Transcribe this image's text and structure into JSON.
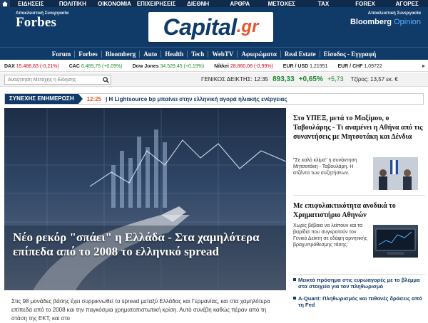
{
  "topnav": {
    "items": [
      "ΕΙΔΗΣΕΙΣ",
      "ΠΟΛΙΤΙΚΗ",
      "ΟΙΚΟΝΟΜΙΑ",
      "ΕΠΙΧΕΙΡΗΣΕΙΣ",
      "ΔΙΕΘΝΗ",
      "ΑΡΘΡΑ",
      "ΜΕΤΟΧΕΣ",
      "TAX",
      "FOREX",
      "ΑΓΟΡΕΣ"
    ]
  },
  "header": {
    "forbes_tag": "Αποκλειστική Συνεργασία",
    "forbes_logo": "Forbes",
    "capital_main": "Capital",
    "capital_tld": ".gr",
    "bloomberg_tag": "Αποκλειστική Συνεργασία",
    "bloomberg_name": "Bloomberg",
    "bloomberg_opinion": "Opinion"
  },
  "categories": [
    "Forum",
    "Forbes",
    "Bloomberg",
    "Auto",
    "Health",
    "Tech",
    "WebTV",
    "Αφιερώματα",
    "Real Estate",
    "Είσοδος - Εγγραφή"
  ],
  "ticker": [
    {
      "name": "DAX",
      "value": "15.486,83",
      "change": "(-0,21%)",
      "dir": "neg"
    },
    {
      "name": "CAC",
      "value": "6.489,75",
      "change": "(+0,09%)",
      "dir": "pos"
    },
    {
      "name": "Dow Jones",
      "value": "34.529,45",
      "change": "(+0,19%)",
      "dir": "pos"
    },
    {
      "name": "Nikkei",
      "value": "28.860,08",
      "change": "(-0,99%)",
      "dir": "neg"
    },
    {
      "name": "EUR / USD",
      "value": "1,21951",
      "change": "",
      "dir": ""
    },
    {
      "name": "EUR / CHF",
      "value": "1,09722",
      "change": "",
      "dir": ""
    }
  ],
  "search": {
    "placeholder": "Αναζήτηση Μετοχής ή Είδησης"
  },
  "index": {
    "label": "ΓΕΝΙΚΟΣ ΔΕΙΚΤΗΣ: 12:35",
    "value": "893,33",
    "percent": "+0,65%",
    "change": "+5,73",
    "volume": "Τζίρος: 13,57 εκ. €"
  },
  "latest": {
    "label": "ΣΥΝΕΧΗΣ ΕΝΗΜΕΡΩΣΗ",
    "time": "12:25",
    "text": "| Η Lightsource bp μπαίνει στην ελληνική αγορά ηλιακής ενέργειας"
  },
  "hero": {
    "title": "Νέο ρεκόρ \"σπάει\" η Ελλάδα - Στα χαμηλότερα επίπεδα από το 2008 το ελληνικό spread",
    "excerpt": "Στις 98 μονάδες βάσης έχει συρρικνωθεί το spread μεταξύ Ελλάδας και Γερμανίας, και στα χαμηλότερα επίπεδα από το 2008 και την παγκόσμια χρηματοπιστωτική κρίση. Αυτό συνέβη καθώς πέραν από τη στάση της ΕΚΤ, και στο"
  },
  "side": {
    "story1_title": "Στο ΥΠΕΞ, μετά το Μαξίμου, ο Ταβουλάρης - Τι αναμένει η Αθήνα από τις συναντήσεις με Μητσοτάκη και Δένδια",
    "story1_excerpt": "\"Σε καλό κλίμα\" η συνάντηση Μητσοτάκη - Ταβουλάρη. Η ατζέντα των συζητήσεων.",
    "story2_title": "Με επιφυλακτικότητα ανοδικά το Χρηματιστήριο Αθηνών",
    "story2_excerpt": "Χωρίς βέβαια να λείπουν και τα βαρίδια που συγκρατούν τον Γενικό Δείκτη σε εδάφη αρνητικής βραχυπρόθεσμης τάσης.",
    "bullet1": "Μεικτά πρόσημα στις ευρωαγορές με το βλέμμα στα στοιχεία για τον πληθωρισμό",
    "bullet2": "A-Quant: Πληθωρισμός και πιθανές δράσεις από τη Fed"
  },
  "colors": {
    "navy": "#103a68",
    "accent": "#e4572e",
    "positive": "#1f8a2a",
    "negative": "#d0021b"
  }
}
